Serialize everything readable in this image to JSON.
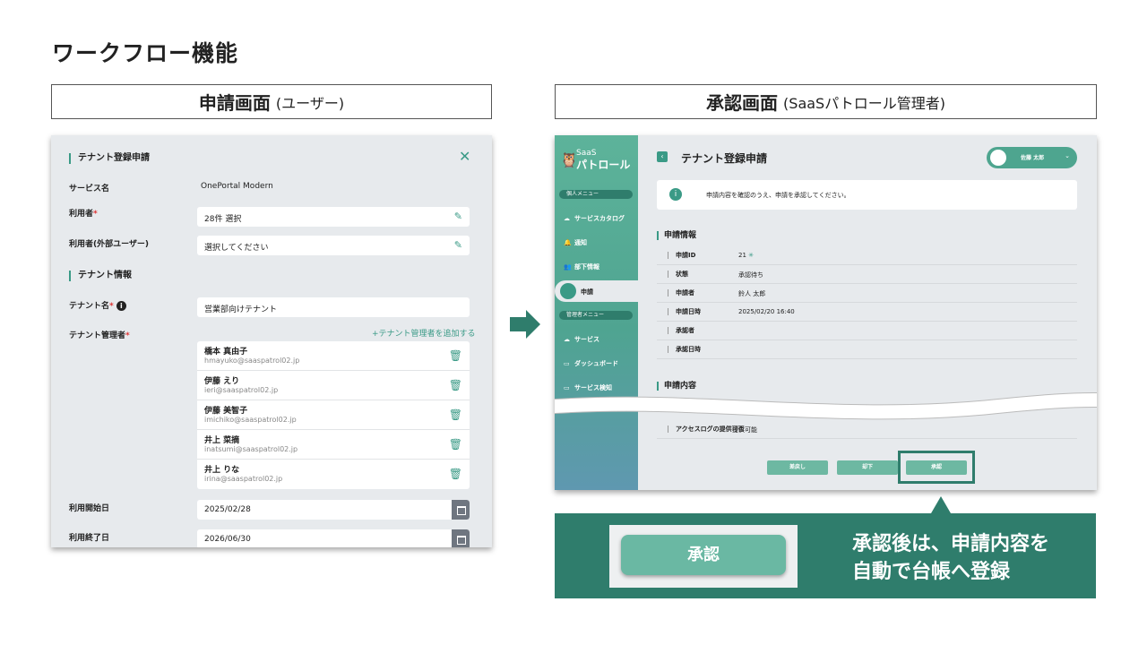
{
  "title": "ワークフロー機能",
  "headers": {
    "left_main": "申請画面",
    "left_sub": "(ユーザー)",
    "right_main": "承認画面",
    "right_sub": "(SaaSパトロール管理者)"
  },
  "form": {
    "section1": "テナント登録申請",
    "service_label": "サービス名",
    "service_value": "OnePortal Modern",
    "user_label": "利用者",
    "user_value": "28件 選択",
    "ext_user_label": "利用者(外部ユーザー)",
    "ext_user_placeholder": "選択してください",
    "section2": "テナント情報",
    "tenant_name_label": "テナント名",
    "tenant_name_value": "営業部向けテナント",
    "tenant_admin_label": "テナント管理者",
    "add_admin": "+テナント管理者を追加する",
    "managers": [
      {
        "name": "橋本 真由子",
        "email": "hmayuko@saaspatrol02.jp"
      },
      {
        "name": "伊藤 えり",
        "email": "ieri@saaspatrol02.jp"
      },
      {
        "name": "伊藤 美智子",
        "email": "imichiko@saaspatrol02.jp"
      },
      {
        "name": "井上 菜摘",
        "email": "inatsumi@saaspatrol02.jp"
      },
      {
        "name": "井上 りな",
        "email": "irina@saaspatrol02.jp"
      }
    ],
    "start_label": "利用開始日",
    "start_value": "2025/02/28",
    "end_label": "利用終了日",
    "end_value": "2026/06/30"
  },
  "approval": {
    "logo_small": "SaaS",
    "logo_main": "パトロール",
    "menu_personal": "個人メニュー",
    "nav_catalog": "サービスカタログ",
    "nav_notice": "通知",
    "nav_subordinate": "部下情報",
    "nav_request": "申請",
    "menu_admin": "管理者メニュー",
    "nav_service": "サービス",
    "nav_dashboard": "ダッシュボード",
    "nav_detect": "サービス検知",
    "panel_title": "テナント登録申請",
    "user_name": "佐藤 太郎",
    "info_text": "申請内容を確認のうえ、申請を承認してください。",
    "section_info": "申請情報",
    "rows": [
      {
        "k": "申請ID",
        "v": "21"
      },
      {
        "k": "状態",
        "v": "承認待ち"
      },
      {
        "k": "申請者",
        "v": "鈴人 太郎"
      },
      {
        "k": "申請日時",
        "v": "2025/02/20 16:40"
      },
      {
        "k": "承認者",
        "v": ""
      },
      {
        "k": "承認日時",
        "v": ""
      }
    ],
    "section_content": "申請内容",
    "row_access_k": "アクセスログの提供可否",
    "row_access_v": "提供可能",
    "btn_return": "差戻し",
    "btn_reject": "却下",
    "btn_approve": "承認"
  },
  "callout": {
    "zoom_button": "承認",
    "line1": "承認後は、申請内容を",
    "line2": "自動で台帳へ登録"
  },
  "colors": {
    "accent": "#3a9a86",
    "dark_green": "#2f7d6c",
    "button_green": "#6db8a2"
  }
}
